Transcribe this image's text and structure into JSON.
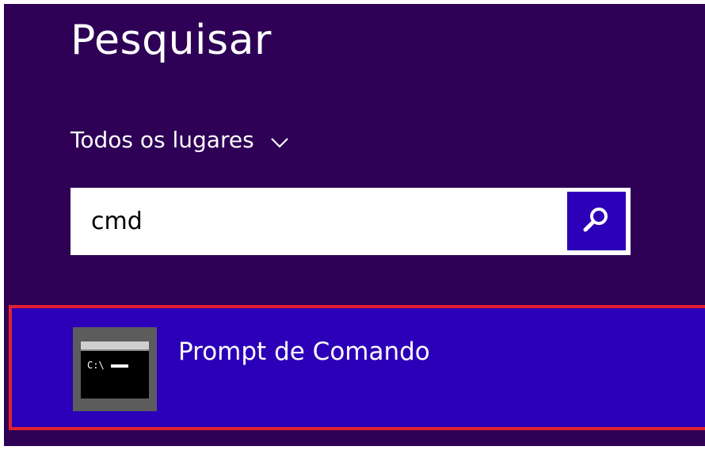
{
  "search_pane": {
    "title": "Pesquisar",
    "scope": {
      "label": "Todos os lugares",
      "icon": "chevron-down-icon"
    },
    "search": {
      "value": "cmd",
      "button_icon": "search-icon"
    },
    "results": [
      {
        "label": "Prompt de Comando",
        "icon": "command-prompt-icon",
        "highlighted": true
      }
    ]
  },
  "colors": {
    "panel_background": "#2e0056",
    "accent": "#2c00b8",
    "highlight_border": "#e0212d",
    "text": "#ffffff"
  }
}
